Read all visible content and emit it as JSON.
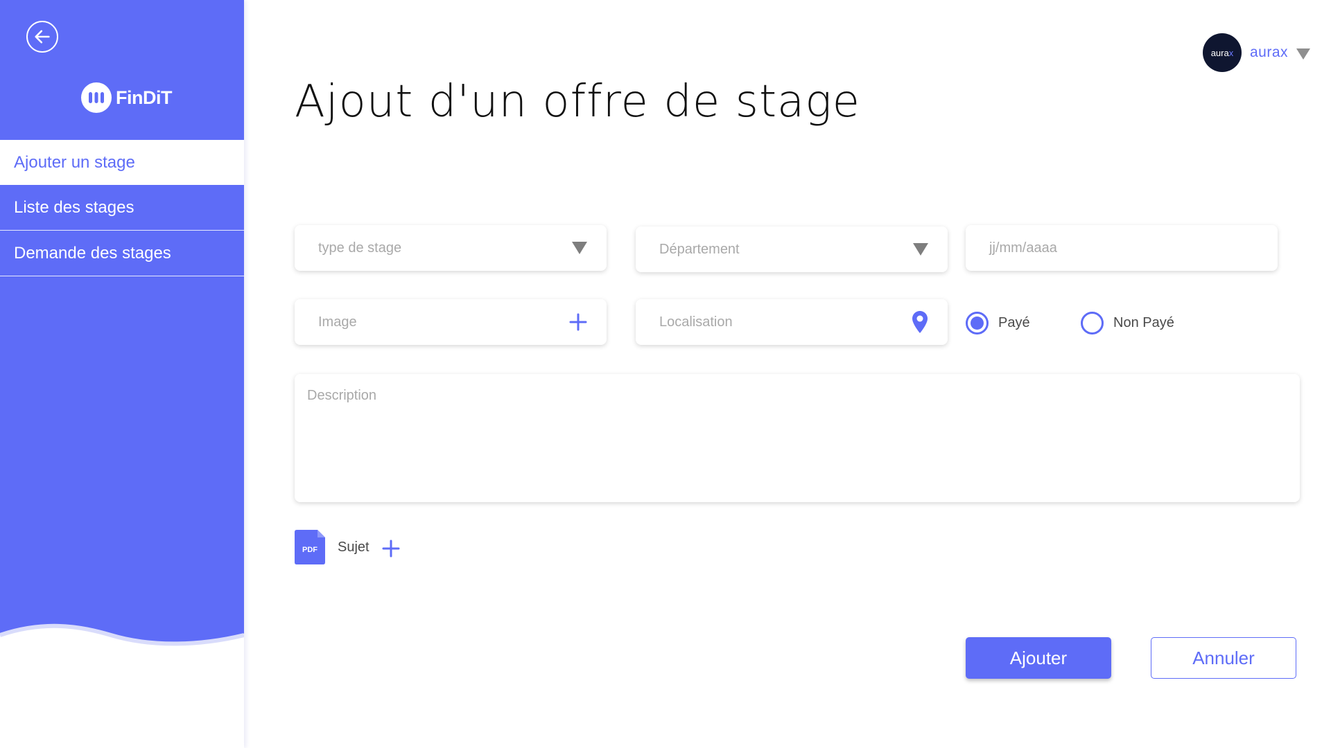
{
  "app": {
    "logo_text": "FinDiT"
  },
  "sidebar": {
    "back_icon": "arrow-left-icon",
    "items": [
      {
        "label": "Ajouter un stage",
        "active": true
      },
      {
        "label": "Liste des stages",
        "active": false
      },
      {
        "label": "Demande des stages",
        "active": false
      }
    ]
  },
  "header": {
    "avatar_text": "aura",
    "avatar_accent": "x",
    "user_name": "aurax",
    "menu_icon": "caret-down-icon"
  },
  "page": {
    "title": "Ajout d'un offre de stage"
  },
  "form": {
    "type_placeholder": "type de stage",
    "department_placeholder": "Département",
    "date_placeholder": "jj/mm/aaaa",
    "image_placeholder": "Image",
    "location_placeholder": "Localisation",
    "payment_options": [
      {
        "label": "Payé",
        "selected": true
      },
      {
        "label": "Non Payé",
        "selected": false
      }
    ],
    "description_placeholder": "Description",
    "subject_file_type": "PDF",
    "subject_label": "Sujet"
  },
  "actions": {
    "submit_label": "Ajouter",
    "cancel_label": "Annuler"
  },
  "colors": {
    "accent": "#5e6cf7",
    "avatar_bg": "#0f1630",
    "placeholder": "#a9a9a9"
  }
}
